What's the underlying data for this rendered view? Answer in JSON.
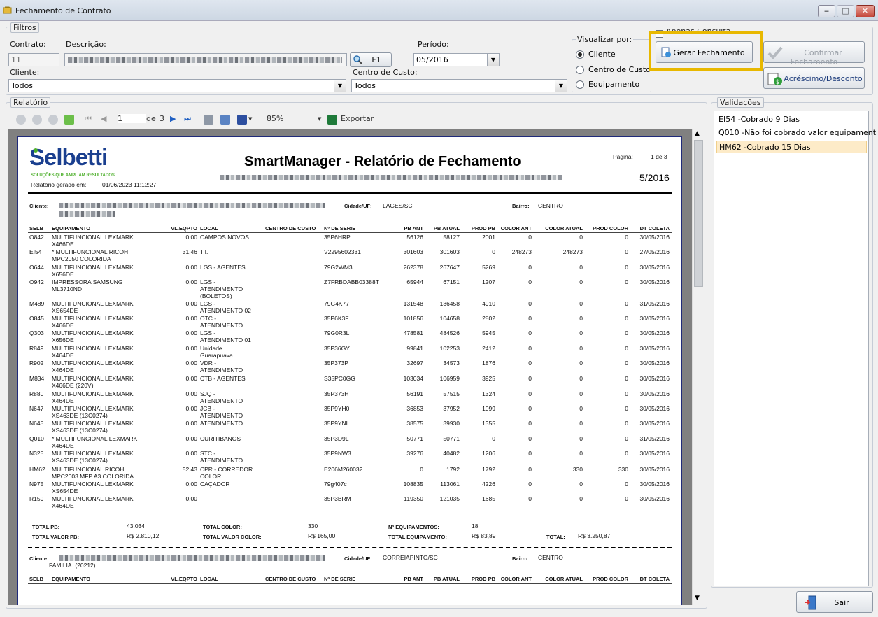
{
  "window": {
    "title": "Fechamento de Contrato",
    "minimize": "‒",
    "maximize": "□",
    "close": "✕"
  },
  "filtros": {
    "legend": "Filtros",
    "contrato_label": "Contrato:",
    "contrato_value": "11",
    "descricao_label": "Descrição:",
    "f1_label": "F1",
    "periodo_label": "Período:",
    "periodo_value": "05/2016",
    "cliente_label": "Cliente:",
    "cliente_value": "Todos",
    "centro_label": "Centro de Custo:",
    "centro_value": "Todos",
    "visualizar_label": "Visualizar por:",
    "radio_options": [
      "Cliente",
      "Centro de Custo",
      "Equipamento"
    ],
    "radio_selected": "Cliente",
    "apenas_label": "Apenas Consulta",
    "gerar_label": "Gerar Fechamento",
    "confirmar_label": "Confirmar Fechamento",
    "acrescimo_label": "Acréscimo/Desconto"
  },
  "relatorio": {
    "legend": "Relatório",
    "page_current": "1",
    "page_of": "de",
    "page_total": "3",
    "zoom": "85%",
    "export_label": "Exportar"
  },
  "report": {
    "logo_text": "Selbetti",
    "logo_tagline": "SOLUÇÕES QUE AMPLIAM RESULTADOS",
    "title": "SmartManager - Relatório de Fechamento",
    "generated_label": "Relatório gerado em:",
    "generated_value": "01/06/2023 11:12:27",
    "pagina_label": "Pagina:",
    "pagina_value": "1 de 3",
    "period": "5/2016",
    "cliente_label": "Cliente:",
    "cidade_label": "Cidade/UF:",
    "cidade_value": "LAGES/SC",
    "bairro_label": "Bairro:",
    "bairro_value": "CENTRO",
    "headers": [
      "SELB",
      "EQUIPAMENTO",
      "VL.EQPTO",
      "LOCAL",
      "CENTRO DE CUSTO",
      "Nº DE SERIE",
      "PB ANT",
      "PB ATUAL",
      "PROD PB",
      "COLOR ANT",
      "COLOR ATUAL",
      "PROD COLOR",
      "DT COLETA"
    ],
    "rows": [
      [
        "O842",
        "MULTIFUNCIONAL LEXMARK X466DE",
        "0,00",
        "CAMPOS NOVOS",
        "",
        "35P6HRP",
        "56126",
        "58127",
        "2001",
        "0",
        "0",
        "0",
        "30/05/2016"
      ],
      [
        "EI54",
        "* MULTIFUNCIONAL RICOH MPC2050 COLORIDA",
        "31,46",
        "T.I.",
        "",
        "V2295602331",
        "301603",
        "301603",
        "0",
        "248273",
        "248273",
        "0",
        "27/05/2016"
      ],
      [
        "O644",
        "MULTIFUNCIONAL LEXMARK X656DE",
        "0,00",
        "LGS - AGENTES",
        "",
        "79G2WM3",
        "262378",
        "267647",
        "5269",
        "0",
        "0",
        "0",
        "30/05/2016"
      ],
      [
        "O942",
        "IMPRESSORA SAMSUNG ML3710ND",
        "0,00",
        "LGS - ATENDIMENTO (BOLETOS)",
        "",
        "Z7FRBDABB03388T",
        "65944",
        "67151",
        "1207",
        "0",
        "0",
        "0",
        "30/05/2016"
      ],
      [
        "M489",
        "MULTIFUNCIONAL LEXMARK XS654DE",
        "0,00",
        "LGS - ATENDIMENTO 02",
        "",
        "79G4K77",
        "131548",
        "136458",
        "4910",
        "0",
        "0",
        "0",
        "31/05/2016"
      ],
      [
        "O845",
        "MULTIFUNCIONAL LEXMARK X466DE",
        "0,00",
        "OTC - ATENDIMENTO",
        "",
        "35P6K3F",
        "101856",
        "104658",
        "2802",
        "0",
        "0",
        "0",
        "30/05/2016"
      ],
      [
        "Q303",
        "MULTIFUNCIONAL LEXMARK X656DE",
        "0,00",
        "LGS - ATENDIMENTO 01",
        "",
        "79G0R3L",
        "478581",
        "484526",
        "5945",
        "0",
        "0",
        "0",
        "30/05/2016"
      ],
      [
        "R849",
        "MULTIFUNCIONAL LEXMARK X464DE",
        "0,00",
        "Unidade Guarapuava",
        "",
        "35P36GY",
        "99841",
        "102253",
        "2412",
        "0",
        "0",
        "0",
        "30/05/2016"
      ],
      [
        "R902",
        "MULTIFUNCIONAL LEXMARK X464DE",
        "0,00",
        "VDR - ATENDIMENTO",
        "",
        "35P373P",
        "32697",
        "34573",
        "1876",
        "0",
        "0",
        "0",
        "30/05/2016"
      ],
      [
        "M834",
        "MULTIFUNCIONAL LEXMARK X466DE (220V)",
        "0,00",
        "CTB - AGENTES",
        "",
        "S35PC0GG",
        "103034",
        "106959",
        "3925",
        "0",
        "0",
        "0",
        "30/05/2016"
      ],
      [
        "R880",
        "MULTIFUNCIONAL LEXMARK X464DE",
        "0,00",
        "SJQ - ATENDIMENTO",
        "",
        "35P373H",
        "56191",
        "57515",
        "1324",
        "0",
        "0",
        "0",
        "30/05/2016"
      ],
      [
        "N647",
        "MULTIFUNCIONAL LEXMARK XS463DE (13C0274)",
        "0,00",
        "JCB - ATENDIMENTO",
        "",
        "35P9YH0",
        "36853",
        "37952",
        "1099",
        "0",
        "0",
        "0",
        "30/05/2016"
      ],
      [
        "N645",
        "MULTIFUNCIONAL LEXMARK XS463DE (13C0274)",
        "0,00",
        "ATENDIMENTO",
        "",
        "35P9YNL",
        "38575",
        "39930",
        "1355",
        "0",
        "0",
        "0",
        "30/05/2016"
      ],
      [
        "Q010",
        "* MULTIFUNCIONAL LEXMARK X464DE",
        "0,00",
        "CURITIBANOS",
        "",
        "35P3D9L",
        "50771",
        "50771",
        "0",
        "0",
        "0",
        "0",
        "31/05/2016"
      ],
      [
        "N325",
        "MULTIFUNCIONAL LEXMARK XS463DE (13C0274)",
        "0,00",
        "STC - ATENDIMENTO",
        "",
        "35P9NW3",
        "39276",
        "40482",
        "1206",
        "0",
        "0",
        "0",
        "30/05/2016"
      ],
      [
        "HM62",
        "MULTIFUNCIONAL RICOH MPC2003 MFP A3 COLORIDA",
        "52,43",
        "CPR - CORREDOR COLOR",
        "",
        "E206M260032",
        "0",
        "1792",
        "1792",
        "0",
        "330",
        "330",
        "30/05/2016"
      ],
      [
        "N975",
        "MULTIFUNCIONAL LEXMARK XS654DE",
        "0,00",
        "CAÇADOR",
        "",
        "79g407c",
        "108835",
        "113061",
        "4226",
        "0",
        "0",
        "0",
        "30/05/2016"
      ],
      [
        "R159",
        "MULTIFUNCIONAL LEXMARK X464DE",
        "0,00",
        "",
        "",
        "35P3BRM",
        "119350",
        "121035",
        "1685",
        "0",
        "0",
        "0",
        "30/05/2016"
      ]
    ],
    "totals": {
      "total_pb_label": "TOTAL PB:",
      "total_pb": "43.034",
      "total_valor_pb_label": "TOTAL VALOR PB:",
      "total_valor_pb": "R$ 2.810,12",
      "total_color_label": "TOTAL COLOR:",
      "total_color": "330",
      "total_valor_color_label": "TOTAL VALOR COLOR:",
      "total_valor_color": "R$ 165,00",
      "n_equip_label": "Nº EQUIPAMENTOS:",
      "n_equip": "18",
      "total_equip_label": "TOTAL EQUIPAMENTO:",
      "total_equip": "R$ 83,89",
      "total_label": "TOTAL:",
      "total": "R$ 3.250,87"
    },
    "cliente2": {
      "cidade_value": "CORREIAPINTO/SC",
      "bairro_value": "CENTRO",
      "extra": "FAMILIA. (20212)"
    }
  },
  "validacoes": {
    "legend": "Validações",
    "items": [
      "EI54 -Cobrado 9 Dias",
      "Q010 -Não foi cobrado valor equipament",
      "HM62 -Cobrado 15 Dias"
    ],
    "selected_index": 2
  },
  "sair_label": "Sair",
  "colors": {
    "highlight": "#e8b800",
    "report_border": "#1f2a7a",
    "logo_green": "#4caf2a",
    "logo_blue": "#1a3f8f"
  }
}
